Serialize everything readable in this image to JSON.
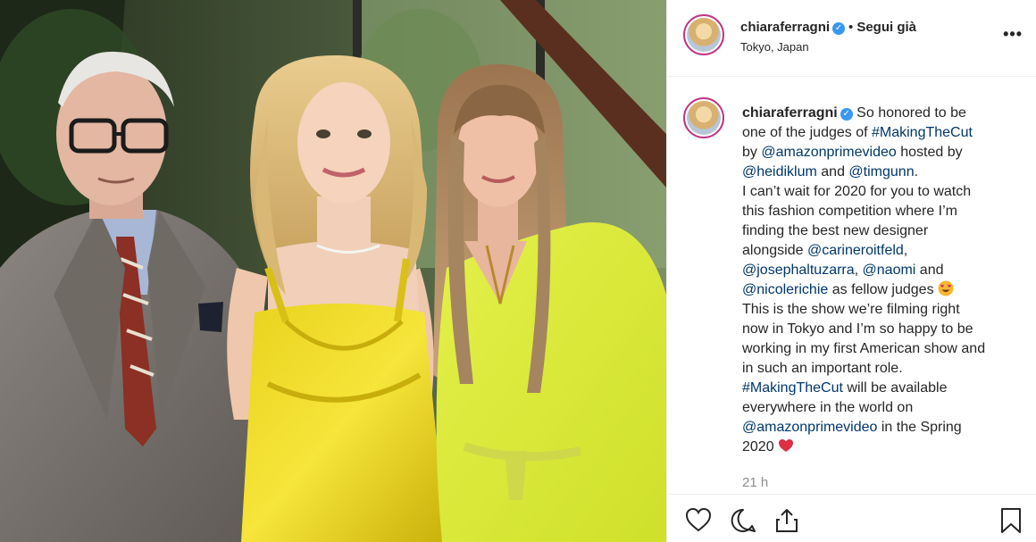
{
  "post": {
    "username": "chiaraferragni",
    "verified": true,
    "follow_status": "Segui già",
    "location": "Tokyo, Japan",
    "more_icon": "more-options-icon",
    "caption": {
      "username": "chiaraferragni",
      "lines": [
        {
          "segments": [
            {
              "t": "So honored to be",
              "tag": false
            }
          ]
        },
        {
          "segments": [
            {
              "t": "one of the judges of ",
              "tag": false
            },
            {
              "t": "#MakingTheCut",
              "tag": true
            }
          ]
        },
        {
          "segments": [
            {
              "t": "by ",
              "tag": false
            },
            {
              "t": "@amazonprimevideo",
              "tag": true
            },
            {
              "t": " hosted by",
              "tag": false
            }
          ]
        },
        {
          "segments": [
            {
              "t": "@heidiklum",
              "tag": true
            },
            {
              "t": " and ",
              "tag": false
            },
            {
              "t": "@timgunn",
              "tag": true
            },
            {
              "t": ".",
              "tag": false
            }
          ]
        },
        {
          "segments": [
            {
              "t": "I can’t wait for 2020 for you to watch",
              "tag": false
            }
          ]
        },
        {
          "segments": [
            {
              "t": "this fashion competition where I’m",
              "tag": false
            }
          ]
        },
        {
          "segments": [
            {
              "t": "finding the best new designer",
              "tag": false
            }
          ]
        },
        {
          "segments": [
            {
              "t": "alongside ",
              "tag": false
            },
            {
              "t": "@carineroitfeld",
              "tag": true
            },
            {
              "t": ",",
              "tag": false
            }
          ]
        },
        {
          "segments": [
            {
              "t": "@josephaltuzarra",
              "tag": true
            },
            {
              "t": ", ",
              "tag": false
            },
            {
              "t": "@naomi",
              "tag": true
            },
            {
              "t": " and",
              "tag": false
            }
          ]
        },
        {
          "segments": [
            {
              "t": "@nicolerichie",
              "tag": true
            },
            {
              "t": " as fellow judges ",
              "tag": false
            }
          ],
          "emoji": "heart-eyes-emoji"
        },
        {
          "segments": [
            {
              "t": "This is the show we’re filming right",
              "tag": false
            }
          ]
        },
        {
          "segments": [
            {
              "t": "now in Tokyo and I’m so happy to be",
              "tag": false
            }
          ]
        },
        {
          "segments": [
            {
              "t": "working in my first American show and",
              "tag": false
            }
          ]
        },
        {
          "segments": [
            {
              "t": "in such an important role.",
              "tag": false
            }
          ]
        },
        {
          "segments": [
            {
              "t": "#MakingTheCut",
              "tag": true
            },
            {
              "t": " will be available",
              "tag": false
            }
          ]
        },
        {
          "segments": [
            {
              "t": "everywhere in the world on",
              "tag": false
            }
          ]
        },
        {
          "segments": [
            {
              "t": "@amazonprimevideo",
              "tag": true
            },
            {
              "t": " in the Spring",
              "tag": false
            }
          ]
        },
        {
          "segments": [
            {
              "t": "2020 ",
              "tag": false
            }
          ],
          "emoji": "red-heart-emoji"
        }
      ]
    },
    "timestamp": "21 h",
    "actions": [
      "like-heart-icon",
      "comment-bubble-icon",
      "share-icon",
      "save-bookmark-icon"
    ]
  },
  "colors": {
    "text": "#262626",
    "link": "#00376b",
    "secondary": "#8e8e8e",
    "verified": "#3897f0",
    "divider": "#efefef"
  }
}
